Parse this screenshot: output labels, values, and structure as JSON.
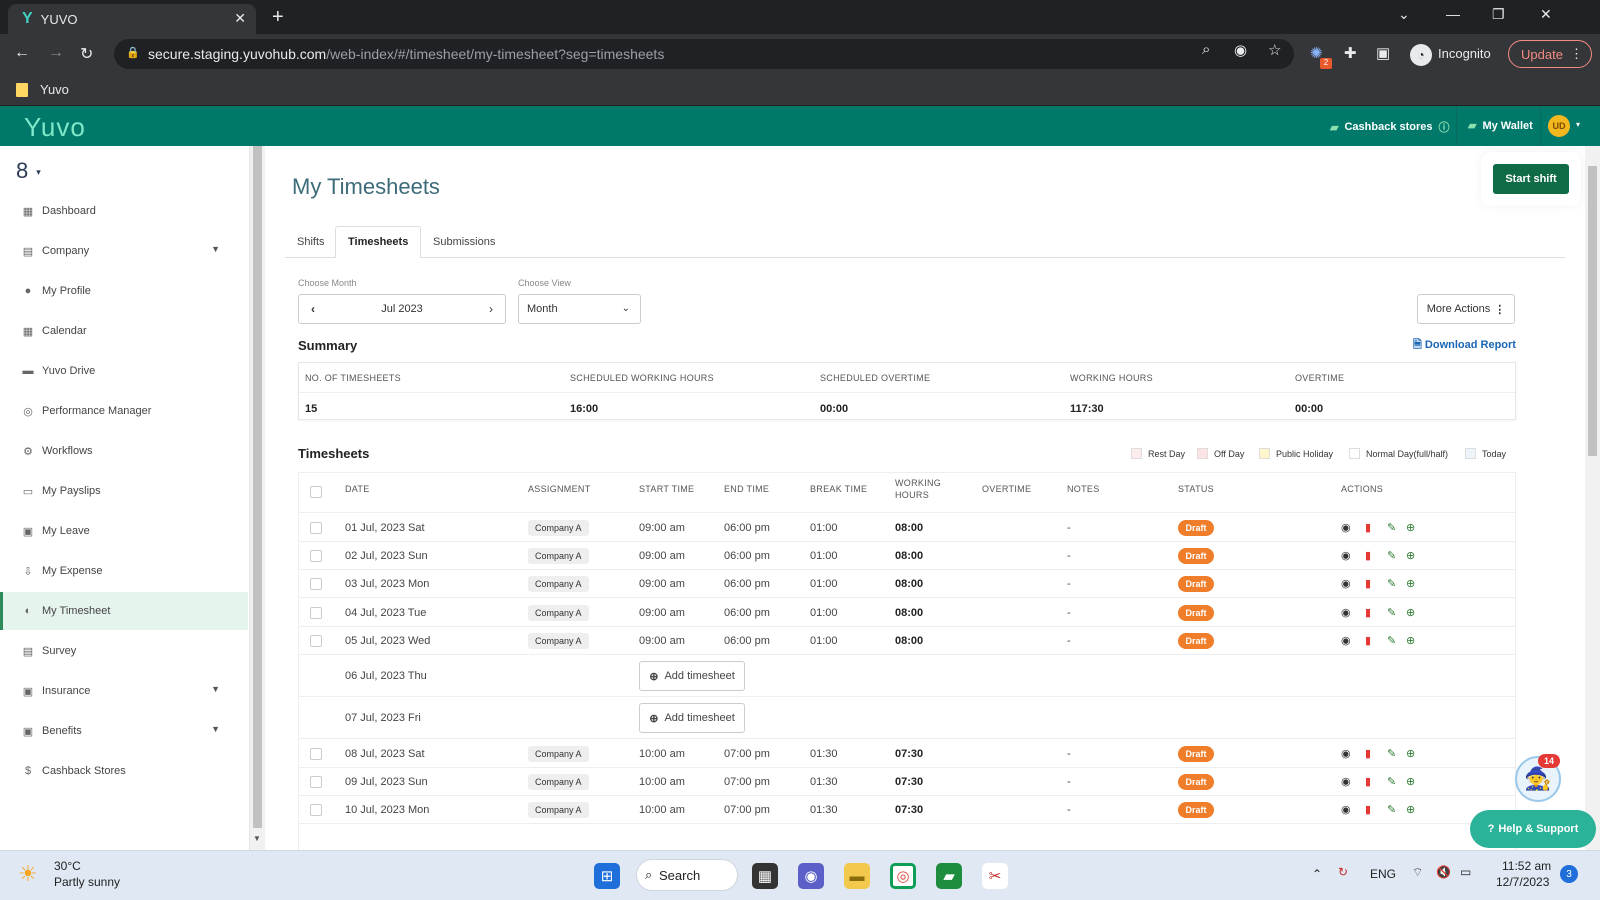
{
  "browser": {
    "tab_title": "YUVO",
    "url_main": "secure.staging.yuvohub.com",
    "url_rest": "/web-index/#/timesheet/my-timesheet?seg=timesheets",
    "profile_label": "Incognito",
    "update_label": "Update",
    "bookmark": "Yuvo",
    "ext_badge": "2"
  },
  "header": {
    "logo": "Yuvo",
    "cashback": "Cashback stores",
    "wallet": "My Wallet",
    "avatar": "UD"
  },
  "sidebar": {
    "items": [
      {
        "label": "Dashboard",
        "icon": "▦"
      },
      {
        "label": "Company",
        "icon": "▤"
      },
      {
        "label": "My Profile",
        "icon": "●"
      },
      {
        "label": "Calendar",
        "icon": "▦"
      },
      {
        "label": "Yuvo Drive",
        "icon": "▬"
      },
      {
        "label": "Performance Manager",
        "icon": "◎"
      },
      {
        "label": "Workflows",
        "icon": "⚙"
      },
      {
        "label": "My Payslips",
        "icon": "▭"
      },
      {
        "label": "My Leave",
        "icon": "▣"
      },
      {
        "label": "My Expense",
        "icon": "⇩"
      },
      {
        "label": "My Timesheet",
        "icon": "◐"
      },
      {
        "label": "Survey",
        "icon": "▤"
      },
      {
        "label": "Insurance",
        "icon": "▣"
      },
      {
        "label": "Benefits",
        "icon": "▣"
      },
      {
        "label": "Cashback Stores",
        "icon": "$"
      }
    ]
  },
  "main": {
    "title": "My Timesheets",
    "start_shift": "Start shift",
    "tabs": [
      "Shifts",
      "Timesheets",
      "Submissions"
    ],
    "choose_month_label": "Choose Month",
    "month_value": "Jul 2023",
    "choose_view_label": "Choose View",
    "view_value": "Month",
    "more_actions": "More Actions",
    "summary_title": "Summary",
    "download_report": "Download Report",
    "summary_headers": [
      "NO. OF TIMESHEETS",
      "SCHEDULED WORKING HOURS",
      "SCHEDULED OVERTIME",
      "WORKING HOURS",
      "OVERTIME"
    ],
    "summary_values": [
      "15",
      "16:00",
      "00:00",
      "117:30",
      "00:00"
    ],
    "timesheets_title": "Timesheets",
    "legend": [
      {
        "label": "Rest Day",
        "color": "#fdecec"
      },
      {
        "label": "Off Day",
        "color": "#fde3e3"
      },
      {
        "label": "Public Holiday",
        "color": "#fff6cc"
      },
      {
        "label": "Normal Day(full/half)",
        "color": "#ffffff"
      },
      {
        "label": "Today",
        "color": "#eef4fb"
      }
    ],
    "columns": [
      "DATE",
      "ASSIGNMENT",
      "START TIME",
      "END TIME",
      "BREAK TIME",
      "WORKING",
      "HOURS",
      "OVERTIME",
      "NOTES",
      "STATUS",
      "ACTIONS"
    ],
    "add_timesheet_label": "Add timesheet",
    "rows": [
      {
        "date": "01 Jul, 2023 Sat",
        "assignment": "Company A",
        "start": "09:00 am",
        "end": "06:00 pm",
        "break": "01:00",
        "hours": "08:00",
        "notes": "-",
        "status": "Draft"
      },
      {
        "date": "02 Jul, 2023 Sun",
        "assignment": "Company A",
        "start": "09:00 am",
        "end": "06:00 pm",
        "break": "01:00",
        "hours": "08:00",
        "notes": "-",
        "status": "Draft"
      },
      {
        "date": "03 Jul, 2023 Mon",
        "assignment": "Company A",
        "start": "09:00 am",
        "end": "06:00 pm",
        "break": "01:00",
        "hours": "08:00",
        "notes": "-",
        "status": "Draft"
      },
      {
        "date": "04 Jul, 2023 Tue",
        "assignment": "Company A",
        "start": "09:00 am",
        "end": "06:00 pm",
        "break": "01:00",
        "hours": "08:00",
        "notes": "-",
        "status": "Draft"
      },
      {
        "date": "05 Jul, 2023 Wed",
        "assignment": "Company A",
        "start": "09:00 am",
        "end": "06:00 pm",
        "break": "01:00",
        "hours": "08:00",
        "notes": "-",
        "status": "Draft"
      },
      {
        "date": "06 Jul, 2023 Thu",
        "empty": true
      },
      {
        "date": "07 Jul, 2023 Fri",
        "empty": true
      },
      {
        "date": "08 Jul, 2023 Sat",
        "assignment": "Company A",
        "start": "10:00 am",
        "end": "07:00 pm",
        "break": "01:30",
        "hours": "07:30",
        "notes": "-",
        "status": "Draft"
      },
      {
        "date": "09 Jul, 2023 Sun",
        "assignment": "Company A",
        "start": "10:00 am",
        "end": "07:00 pm",
        "break": "01:30",
        "hours": "07:30",
        "notes": "-",
        "status": "Draft"
      },
      {
        "date": "10 Jul, 2023 Mon",
        "assignment": "Company A",
        "start": "10:00 am",
        "end": "07:00 pm",
        "break": "01:30",
        "hours": "07:30",
        "notes": "-",
        "status": "Draft"
      }
    ],
    "help": "Help & Support",
    "bot_badge": "14"
  },
  "taskbar": {
    "temp": "30°C",
    "weather": "Partly sunny",
    "search": "Search",
    "lang": "ENG",
    "time": "11:52 am",
    "date": "12/7/2023",
    "notif": "3"
  },
  "colors": {
    "brand": "#00796b",
    "accent": "#0e6b45",
    "draft": "#ef7d29"
  }
}
